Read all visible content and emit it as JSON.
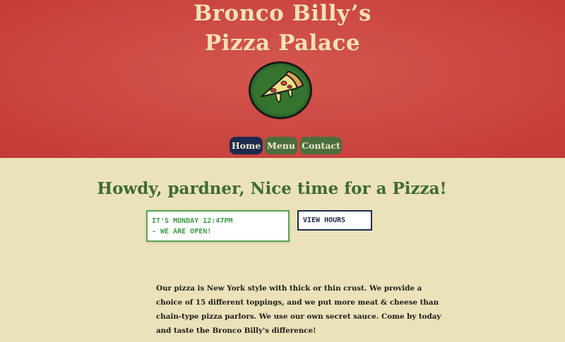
{
  "header": {
    "title_line1": "Bronco Billy’s",
    "title_line2": "Pizza Palace",
    "logo": "pizza-slice-logo"
  },
  "nav": {
    "items": [
      {
        "label": "Home",
        "active": true
      },
      {
        "label": "Menu",
        "active": false
      },
      {
        "label": "Contact",
        "active": false
      }
    ]
  },
  "main": {
    "headline": "Howdy, pardner, Nice time for a Pizza!",
    "status": {
      "line1": "IT'S MONDAY 12:47PM",
      "line2": "- WE ARE OPEN!"
    },
    "view_hours_label": "VIEW HOURS",
    "about_lines": [
      "Our pizza is New York style with thick or thin crust. We provide a",
      "choice of 15 different toppings, and we put more meat & cheese than",
      "chain-type pizza parlors. We use our own secret sauce. Come by today",
      "and taste the Bronco Billy's difference!"
    ]
  },
  "colors": {
    "header_red": "#cd4a45",
    "cream": "#ebe2b9",
    "navy": "#1c2b4e",
    "green": "#4a6e3c",
    "status_green": "#3e9a48"
  }
}
